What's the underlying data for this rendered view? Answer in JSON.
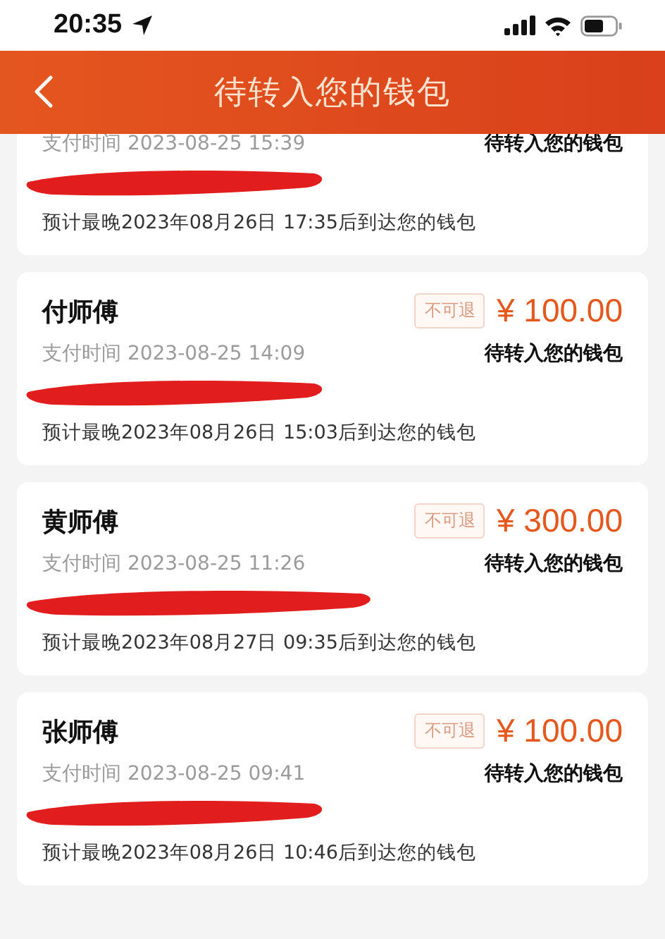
{
  "status_bar": {
    "time": "20:35"
  },
  "header": {
    "title": "待转入您的钱包"
  },
  "orders": [
    {
      "time_label": "支付时间 2023-08-25 15:39",
      "status": "待转入您的钱包",
      "estimate": "预计最晚2023年08月26日 17:35后到达您的钱包"
    },
    {
      "name": "付师傅",
      "badge": "不可退",
      "price": "¥ 100.00",
      "time_label": "支付时间 2023-08-25 14:09",
      "status": "待转入您的钱包",
      "estimate": "预计最晚2023年08月26日 15:03后到达您的钱包"
    },
    {
      "name": "黄师傅",
      "badge": "不可退",
      "price": "¥ 300.00",
      "time_label": "支付时间 2023-08-25 11:26",
      "status": "待转入您的钱包",
      "estimate": "预计最晚2023年08月27日 09:35后到达您的钱包"
    },
    {
      "name": "张师傅",
      "badge": "不可退",
      "price": "¥ 100.00",
      "time_label": "支付时间 2023-08-25 09:41",
      "status": "待转入您的钱包",
      "estimate": "预计最晚2023年08月26日 10:46后到达您的钱包"
    }
  ]
}
